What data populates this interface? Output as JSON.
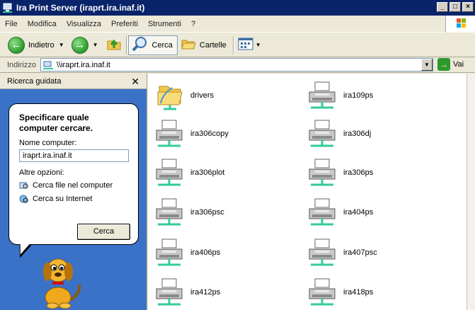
{
  "window": {
    "title": "Ira Print Server (iraprt.ira.inaf.it)"
  },
  "menu": [
    "File",
    "Modifica",
    "Visualizza",
    "Preferiti",
    "Strumenti",
    "?"
  ],
  "toolbar": {
    "back_label": "Indietro",
    "search_label": "Cerca",
    "folders_label": "Cartelle"
  },
  "address": {
    "label": "Indirizzo",
    "value": "\\\\iraprt.ira.inaf.it",
    "go_label": "Vai"
  },
  "search_pane": {
    "header": "Ricerca guidata",
    "prompt": "Specificare quale computer cercare.",
    "field_label": "Nome computer:",
    "field_value": "iraprt.ira.inaf.it",
    "other_options": "Altre opzioni:",
    "links": [
      "Cerca file nel computer",
      "Cerca su Internet"
    ],
    "search_button": "Cerca"
  },
  "items": [
    {
      "name": "drivers",
      "type": "folder"
    },
    {
      "name": "ira109ps",
      "type": "printer"
    },
    {
      "name": "ira306copy",
      "type": "printer"
    },
    {
      "name": "ira306dj",
      "type": "printer"
    },
    {
      "name": "ira306plot",
      "type": "printer"
    },
    {
      "name": "ira306ps",
      "type": "printer"
    },
    {
      "name": "ira306psc",
      "type": "printer"
    },
    {
      "name": "ira404ps",
      "type": "printer"
    },
    {
      "name": "ira406ps",
      "type": "printer"
    },
    {
      "name": "ira407psc",
      "type": "printer"
    },
    {
      "name": "ira412ps",
      "type": "printer"
    },
    {
      "name": "ira418ps",
      "type": "printer"
    }
  ]
}
